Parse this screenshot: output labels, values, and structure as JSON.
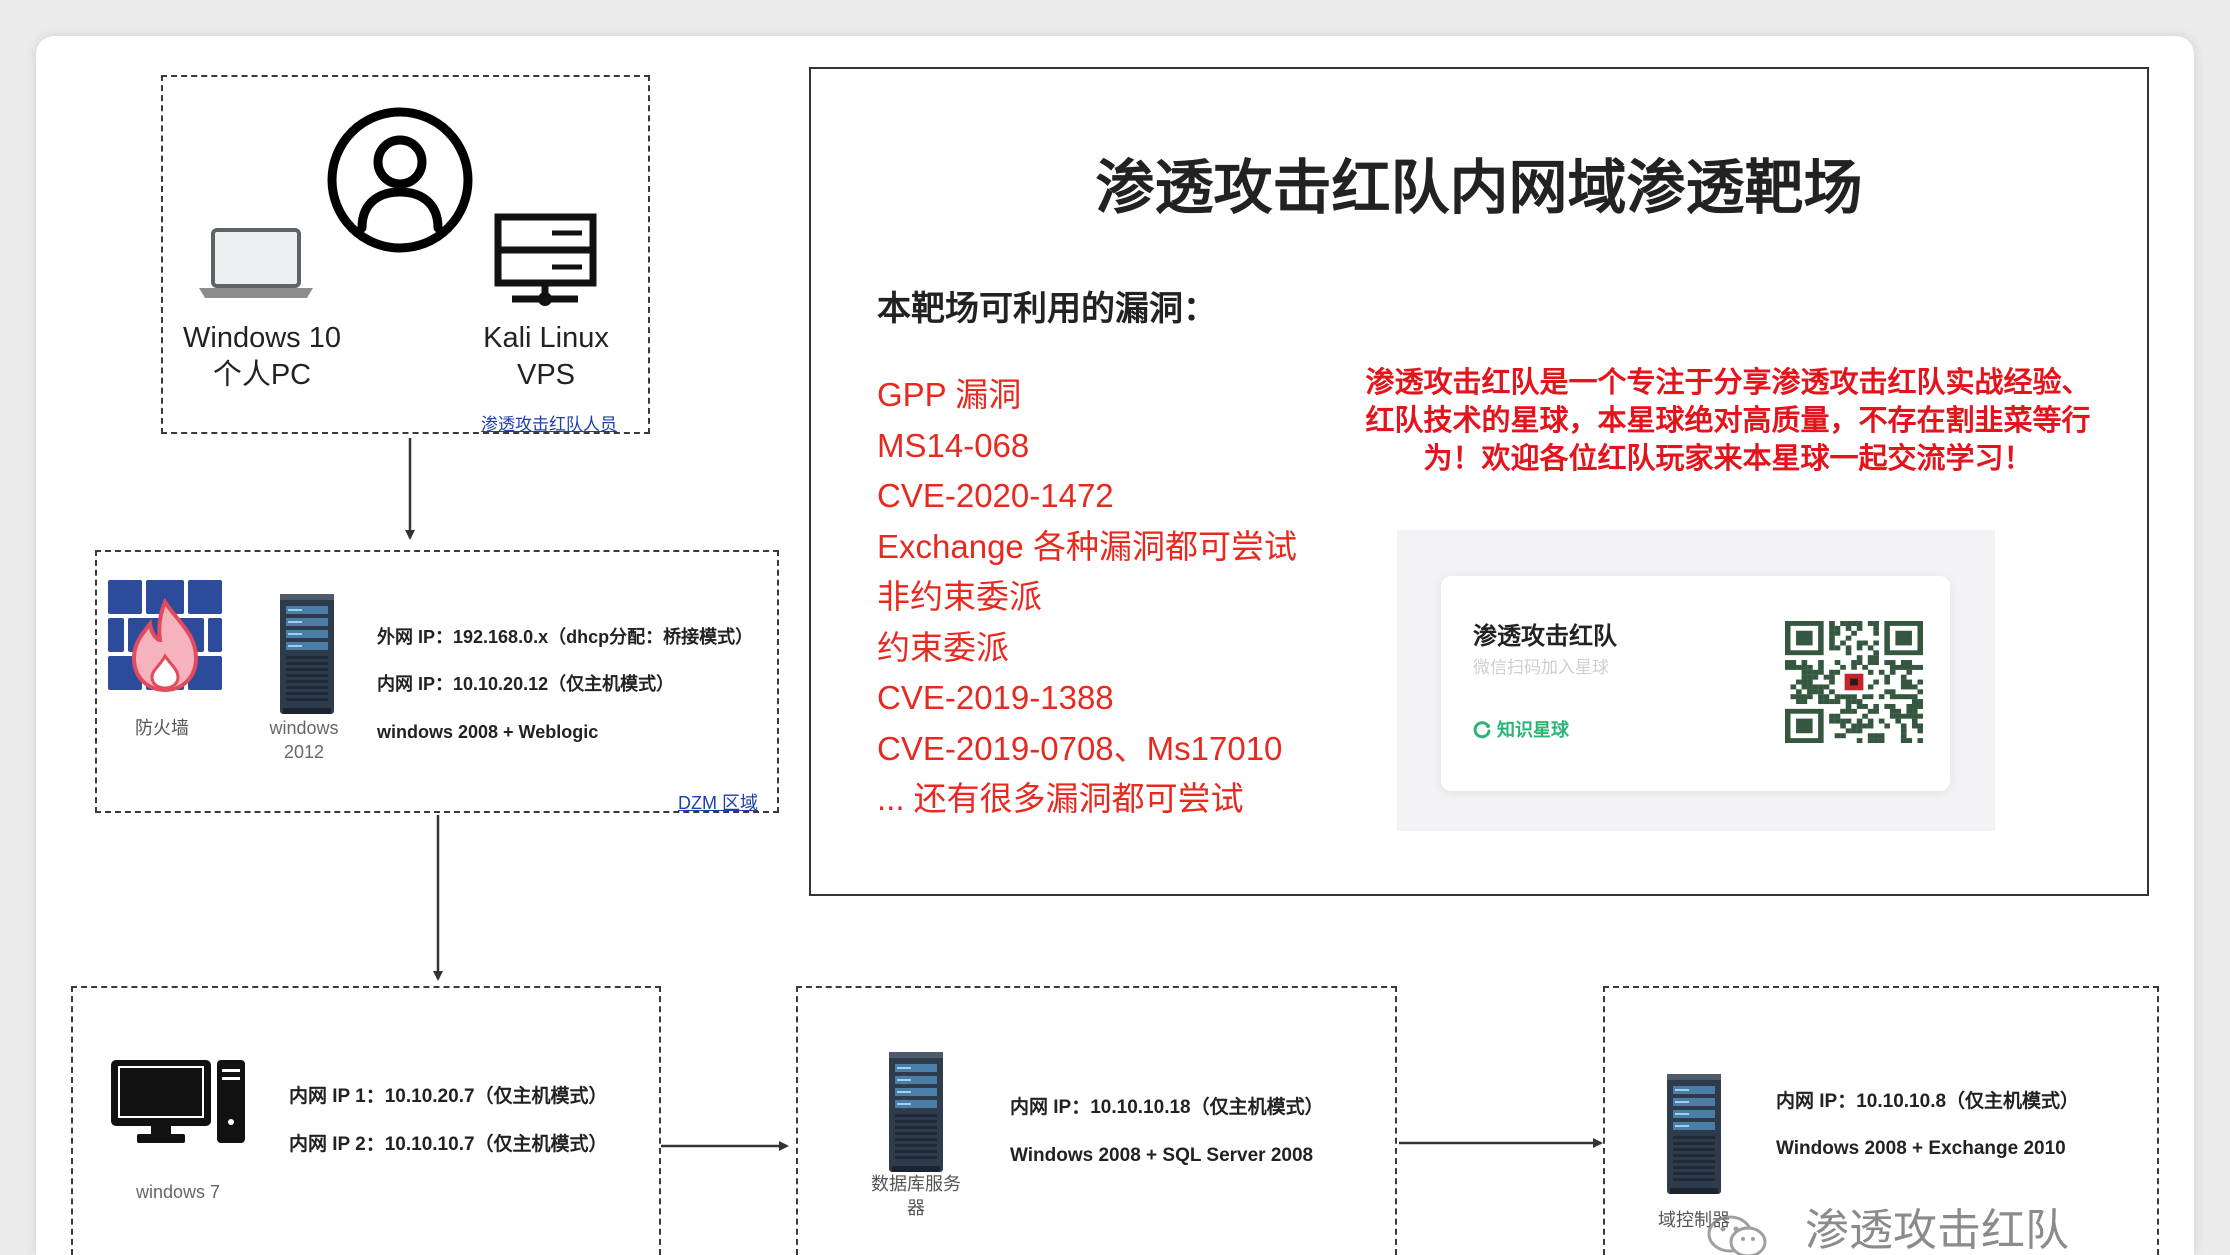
{
  "attacker": {
    "pc_label": "Windows 10",
    "pc_sublabel": "个人PC",
    "vps_label": "Kali Linux",
    "vps_sublabel": "VPS",
    "zone_label": "渗透攻击红队人员"
  },
  "dmz": {
    "firewall_label": "防火墙",
    "server_label_1": "windows",
    "server_label_2": "2012",
    "lines": [
      "外网 IP：192.168.0.x（dhcp分配：桥接模式）",
      "内网 IP：10.10.20.12（仅主机模式）",
      "windows 2008 + Weblogic"
    ],
    "zone_label": "DZM 区域"
  },
  "info": {
    "title": "渗透攻击红队内网域渗透靶场",
    "subtitle": "本靶场可利用的漏洞：",
    "vulns": [
      "GPP 漏洞",
      "MS14-068",
      "CVE-2020-1472",
      "Exchange 各种漏洞都可尝试",
      "非约束委派",
      "约束委派",
      "CVE-2019-1388",
      "CVE-2019-0708、Ms17010",
      "... 还有很多漏洞都可尝试"
    ],
    "promo": [
      "渗透攻击红队是一个专注于分享渗透攻击红队实战经验、",
      "红队技术的星球，本星球绝对高质量，不存在割韭菜等行",
      "为！欢迎各位红队玩家来本星球一起交流学习！"
    ],
    "qr_card": {
      "name": "渗透攻击红队",
      "hint": "微信扫码加入星球",
      "brand": "知识星球"
    }
  },
  "internal": {
    "win7": {
      "label": "windows 7",
      "lines": [
        "内网 IP 1：10.10.20.7（仅主机模式）",
        "内网 IP 2：10.10.10.7（仅主机模式）"
      ]
    },
    "db": {
      "label_1": "数据库服务",
      "label_2": "器",
      "lines": [
        "内网 IP：10.10.10.18（仅主机模式）",
        "Windows 2008 + SQL Server 2008"
      ]
    },
    "dc": {
      "label": "域控制器",
      "lines": [
        "内网 IP：10.10.10.8（仅主机模式）",
        "Windows 2008 + Exchange 2010"
      ]
    }
  },
  "watermark": "渗透攻击红队",
  "icons": {
    "attacker": "person-circle-icon",
    "pc": "laptop-icon",
    "vps": "server-rack-icon",
    "firewall": "firewall-icon",
    "server": "server-tower-icon",
    "desktop": "desktop-computer-icon",
    "qr": "qr-code-icon",
    "planet": "knowledge-planet-icon",
    "wechat": "wechat-icon"
  },
  "colors": {
    "vuln_text": "#e8291f",
    "promo_text": "#e3141c",
    "zone_link": "#1d3fad",
    "brand_green": "#2ab574",
    "qr_module": "#35573f",
    "firewall_blue": "#2d4b9b"
  }
}
